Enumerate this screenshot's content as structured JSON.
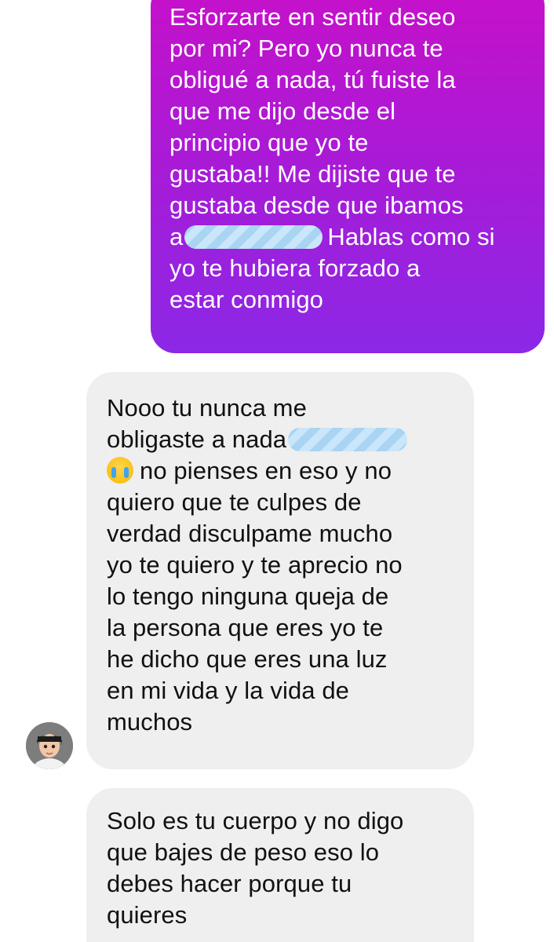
{
  "messages": [
    {
      "direction": "sent",
      "lines": [
        "Esforzarte en sentir deseo",
        "por mi? Pero yo nunca te",
        "obligué a nada, tú fuiste la",
        "que me dijo desde el",
        "principio que yo te",
        "gustaba!! Me dijiste que te",
        "gustaba desde que ibamos",
        "a",
        "Hablas como si",
        "yo te hubiera forzado a",
        "estar conmigo"
      ]
    },
    {
      "direction": "received",
      "lines": [
        "Nooo tu nunca me",
        "obligaste a nada",
        "no pienses en eso y no",
        "quiero que te culpes de",
        "verdad disculpame mucho",
        "yo te quiero y te aprecio no",
        "lo tengo ninguna queja de",
        "la persona que eres yo te",
        "he dicho que eres una luz",
        "en mi vida y la vida de",
        "muchos"
      ]
    },
    {
      "direction": "received",
      "lines": [
        "Solo es tu cuerpo y no digo",
        "que bajes de peso eso lo",
        "debes hacer porque tu",
        "quieres"
      ]
    }
  ],
  "icons": {
    "emoji": "loudly-crying-face-icon",
    "avatar": "contact-avatar"
  },
  "colors": {
    "sent_gradient_top": "#c710c9",
    "sent_gradient_bottom": "#8b28e6",
    "received_bubble": "#efefef",
    "redaction": "#a9d4f2"
  }
}
